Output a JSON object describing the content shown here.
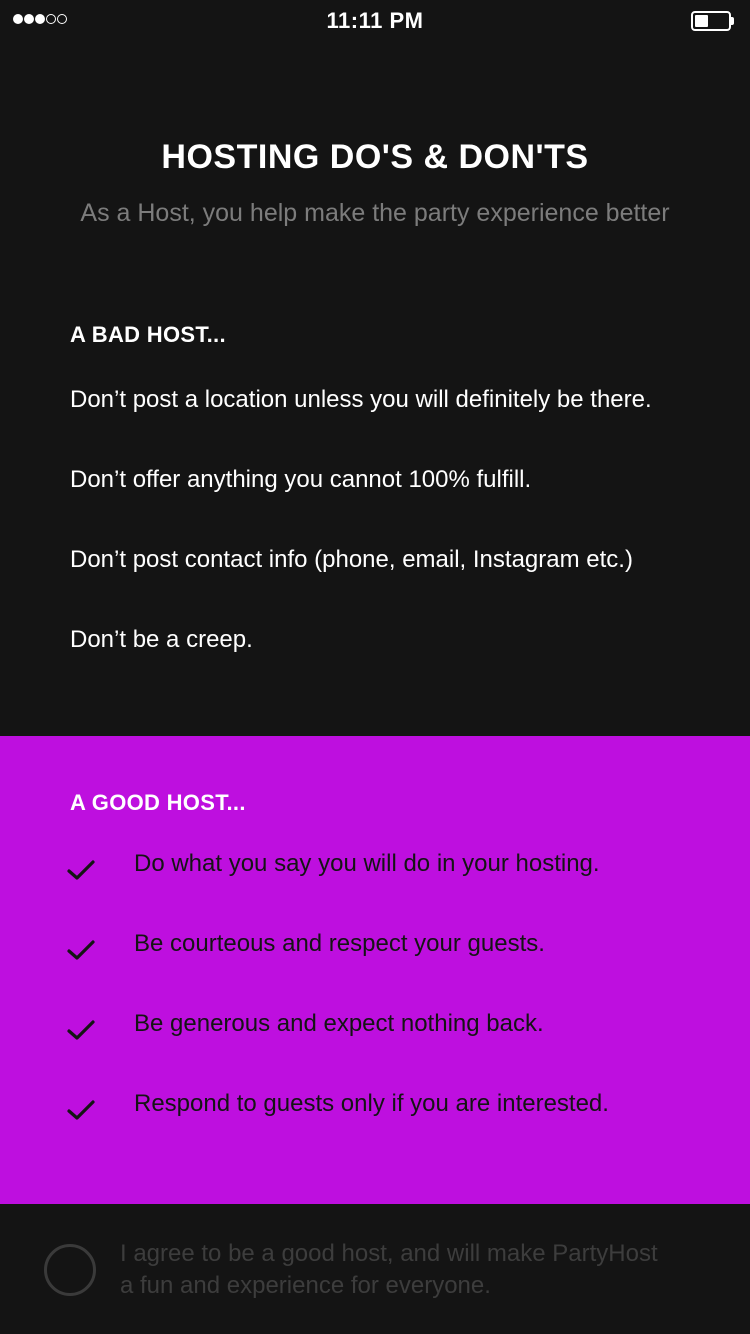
{
  "status_bar": {
    "time": "11:11 PM",
    "signal_bars_filled": 3,
    "signal_bars_total": 5,
    "battery_level": 0.4
  },
  "header": {
    "title": "HOSTING DO'S & DON'TS",
    "subtitle": "As a Host, you help make the party experience better"
  },
  "bad_host": {
    "heading": "A BAD HOST...",
    "rules": [
      "Don’t post a location unless you will definitely be there.",
      "Don’t offer anything you cannot 100% fulfill.",
      "Don’t post contact info (phone, email, Instagram etc.)",
      "Don’t be a creep."
    ]
  },
  "good_host": {
    "heading": "A GOOD HOST...",
    "accent_color": "#be0fdf",
    "check_icon": "checkmark-icon",
    "rules": [
      "Do what you say you will do in your hosting.",
      "Be courteous and respect your guests.",
      "Be generous and expect nothing back.",
      "Respond to guests only if you are interested."
    ]
  },
  "agreement": {
    "checked": false,
    "text_line1": "I agree to be a good host, and will make PartyHost",
    "text_line2": "a fun and experience for everyone."
  }
}
